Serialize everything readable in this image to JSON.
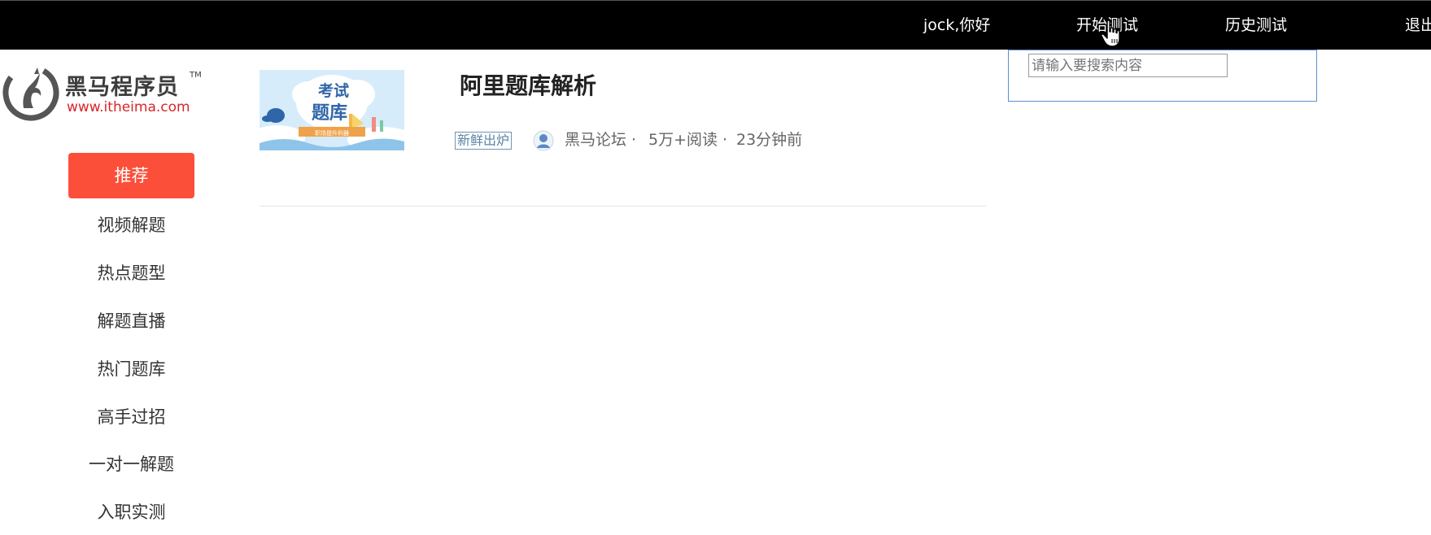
{
  "header": {
    "greeting": "jock,你好",
    "start_test": "开始测试",
    "history_test": "历史测试",
    "logout": "退出"
  },
  "search": {
    "placeholder": "请输入要搜索内容",
    "value": ""
  },
  "logo": {
    "name": "黑马程序员",
    "trademark": "TM",
    "url": "www.itheima.com"
  },
  "menu": {
    "items": [
      {
        "label": "推荐",
        "active": true
      },
      {
        "label": "视频解题",
        "active": false
      },
      {
        "label": "热点题型",
        "active": false
      },
      {
        "label": "解题直播",
        "active": false
      },
      {
        "label": "热门题库",
        "active": false
      },
      {
        "label": "高手过招",
        "active": false
      },
      {
        "label": "一对一解题",
        "active": false
      },
      {
        "label": "入职实测",
        "active": false
      }
    ]
  },
  "article": {
    "thumb_line1": "考试",
    "thumb_line2": "题库",
    "thumb_ribbon": "职场提升利器",
    "title": "阿里题库解析",
    "tag": "新鲜出炉",
    "source": "黑马论坛 ·",
    "reads": "5万+阅读 ·",
    "time": "23分钟前"
  },
  "colors": {
    "topbar_bg": "#000000",
    "accent": "#fc4f3a",
    "logo_url_red": "#d8262a",
    "search_border": "#5b8fd6",
    "tag_blue": "#5a84a8"
  },
  "icons": {
    "cursor": "hand-pointer-icon",
    "logo": "horse-logo-icon",
    "avatar": "forum-avatar-icon"
  }
}
